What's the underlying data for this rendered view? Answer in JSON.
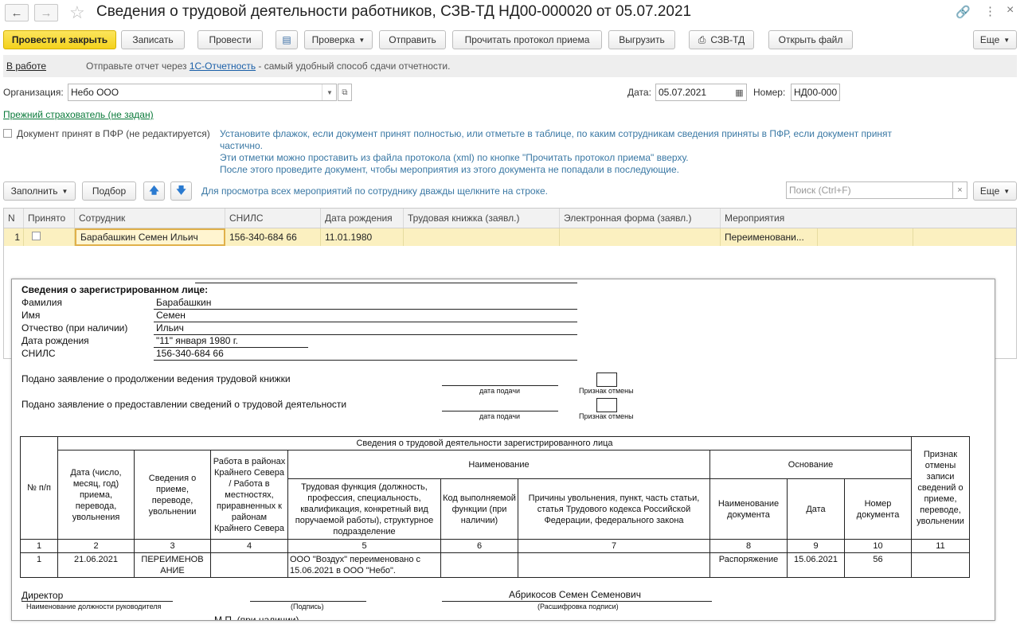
{
  "window": {
    "title": "Сведения о трудовой деятельности работников, СЗВ-ТД НД00-000020 от 05.07.2021"
  },
  "toolbar": {
    "post_close": "Провести и закрыть",
    "write": "Записать",
    "post": "Провести",
    "check": "Проверка",
    "send": "Отправить",
    "read_protocol": "Прочитать протокол приема",
    "upload": "Выгрузить",
    "print_szv": "СЗВ-ТД",
    "open_file": "Открыть файл",
    "more": "Еще"
  },
  "status": {
    "state": "В работе",
    "text_before": "Отправьте отчет через ",
    "link": "1С-Отчетность",
    "text_after": " - самый удобный способ сдачи отчетности."
  },
  "header": {
    "org_label": "Организация:",
    "org_value": "Небо ООО",
    "date_label": "Дата:",
    "date_value": "05.07.2021",
    "number_label": "Номер:",
    "number_value": "НД00-000",
    "prev_insurer": "Прежний страхователь (не задан)",
    "accepted_label": "Документ принят в ПФР (не редактируется)",
    "hint1": "Установите флажок, если документ принят полностью, или отметьте в таблице, по каким сотрудникам сведения приняты в ПФР, если документ принят",
    "hint2": "частично.",
    "hint3": "Эти отметки можно проставить из файла протокола (xml) по кнопке \"Прочитать протокол приема\" вверху.",
    "hint4": "После этого проведите документ, чтобы мероприятия из этого документа не попадали в последующие."
  },
  "table_toolbar": {
    "fill": "Заполнить",
    "select": "Подбор",
    "hint": "Для просмотра всех мероприятий по сотруднику дважды щелкните на строке.",
    "search_placeholder": "Поиск (Ctrl+F)",
    "more": "Еще"
  },
  "grid": {
    "columns": [
      "N",
      "Принято",
      "Сотрудник",
      "СНИЛС",
      "Дата рождения",
      "Трудовая книжка (заявл.)",
      "Электронная форма (заявл.)",
      "Мероприятия"
    ],
    "row": {
      "n": "1",
      "employee": "Барабашкин Семен Ильич",
      "snils": "156-340-684 66",
      "birth": "11.01.1980",
      "events": "Переименовани..."
    }
  },
  "printform": {
    "section_title": "Сведения о зарегистрированном лице:",
    "surname_label": "Фамилия",
    "surname": "Барабашкин",
    "name_label": "Имя",
    "name": "Семен",
    "patronymic_label": "Отчество (при наличии)",
    "patronymic": "Ильич",
    "birth_label": "Дата рождения",
    "birth": "\"11\" января 1980 г.",
    "snils_label": "СНИЛС",
    "snils": "156-340-684 66",
    "app1": "Подано заявление о продолжении ведения трудовой книжки",
    "app2": "Подано заявление о предоставлении сведений о трудовой деятельности",
    "date_submit": "дата подачи",
    "cancel_sign": "Признак отмены",
    "table": {
      "main_header": "Сведения о трудовой деятельности зарегистрированного лица",
      "col_num": "№ п/п",
      "col_date": "Дата (число, месяц, год) приема, перевода, увольнения",
      "col_info": "Сведения о приеме, переводе, увольнении",
      "col_north": "Работа в районах Крайнего Севера / Работа в местностях, приравненных к районам Крайнего Севера",
      "col_name": "Наименование",
      "col_func": "Трудовая функция (должность, профессия, специальность, квалификация, конкретный вид поручаемой работы), структурное подразделение",
      "col_code": "Код выполняемой функции (при наличии)",
      "col_reason": "Причины увольнения, пункт, часть статьи, статья Трудового кодекса Российской Федерации, федерального закона",
      "col_basis": "Основание",
      "col_docname": "Наименование документа",
      "col_docdate": "Дата",
      "col_docnum": "Номер документа",
      "col_cancel": "Признак отмены записи сведений о приеме, переводе, увольнении",
      "nums": [
        "1",
        "2",
        "3",
        "4",
        "5",
        "6",
        "7",
        "8",
        "9",
        "10",
        "11"
      ],
      "row": {
        "num": "1",
        "date": "21.06.2021",
        "info": "ПЕРЕИМЕНОВ АНИЕ",
        "north": "",
        "func": "ООО \"Воздух\" переименовано с 15.06.2021 в ООО \"Небо\".",
        "code": "",
        "reason": "",
        "docname": "Распоряжение",
        "docdate": "15.06.2021",
        "docnum": "56",
        "cancel": ""
      }
    },
    "footer": {
      "position": "Директор",
      "position_caption": "Наименование должности руководителя",
      "sign_caption": "(Подпись)",
      "fio": "Абрикосов Семен Семенович",
      "fio_caption": "(Расшифровка подписи)",
      "mp": "М.П. (при наличии)"
    }
  }
}
